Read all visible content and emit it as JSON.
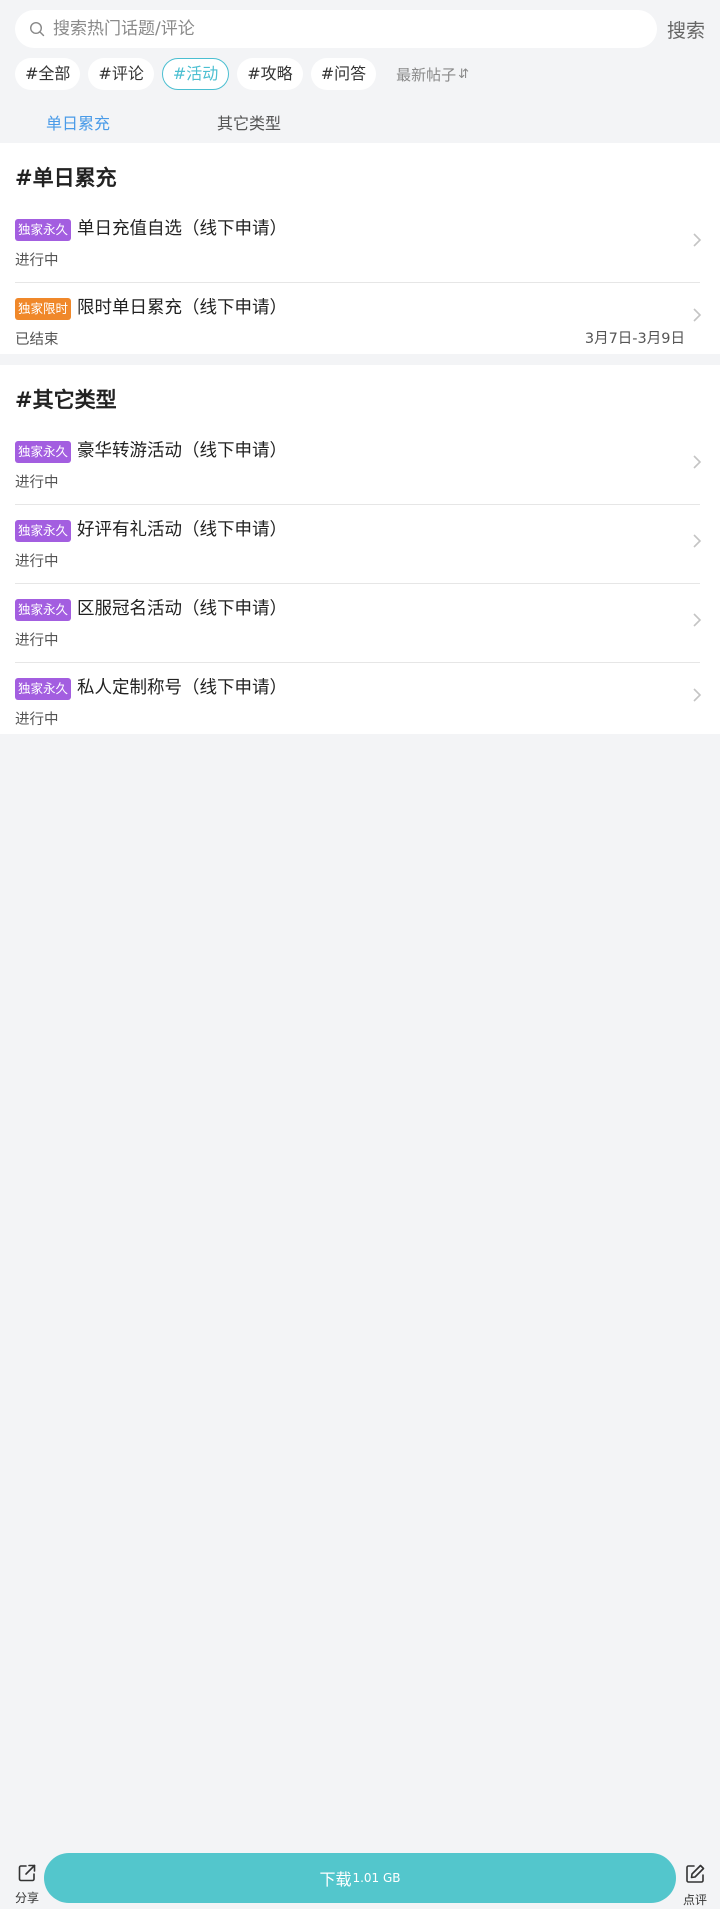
{
  "search": {
    "placeholder": "搜索热门话题/评论",
    "button_label": "搜索"
  },
  "tags": [
    {
      "label": "#全部",
      "active": false
    },
    {
      "label": "#评论",
      "active": false
    },
    {
      "label": "#活动",
      "active": true
    },
    {
      "label": "#攻略",
      "active": false
    },
    {
      "label": "#问答",
      "active": false
    }
  ],
  "sort": {
    "label": "最新帖子",
    "icon": "sort-arrows-icon"
  },
  "subtabs": [
    {
      "label": "单日累充",
      "active": true
    },
    {
      "label": "其它类型",
      "active": false
    }
  ],
  "sections": [
    {
      "title": "#单日累充",
      "items": [
        {
          "badge": "独家永久",
          "badge_color": "#a35ee0",
          "title": "单日充值自选（线下申请）",
          "status": "进行中",
          "date": ""
        },
        {
          "badge": "独家限时",
          "badge_color": "#f0882a",
          "title": "限时单日累充（线下申请）",
          "status": "已结束",
          "date": "3月7日-3月9日"
        }
      ]
    },
    {
      "title": "#其它类型",
      "items": [
        {
          "badge": "独家永久",
          "badge_color": "#a35ee0",
          "title": "豪华转游活动（线下申请）",
          "status": "进行中",
          "date": ""
        },
        {
          "badge": "独家永久",
          "badge_color": "#a35ee0",
          "title": "好评有礼活动（线下申请）",
          "status": "进行中",
          "date": ""
        },
        {
          "badge": "独家永久",
          "badge_color": "#a35ee0",
          "title": "区服冠名活动（线下申请）",
          "status": "进行中",
          "date": ""
        },
        {
          "badge": "独家永久",
          "badge_color": "#a35ee0",
          "title": "私人定制称号（线下申请）",
          "status": "进行中",
          "date": ""
        }
      ]
    }
  ],
  "bottom": {
    "share_label": "分享",
    "download_label": "下载",
    "download_size": "1.01 GB",
    "review_label": "点评"
  },
  "colors": {
    "accent": "#4bbfd1",
    "download": "#53c6cc",
    "subtab_active": "#4a9be8",
    "badge_permanent": "#a35ee0",
    "badge_limited": "#f0882a"
  }
}
